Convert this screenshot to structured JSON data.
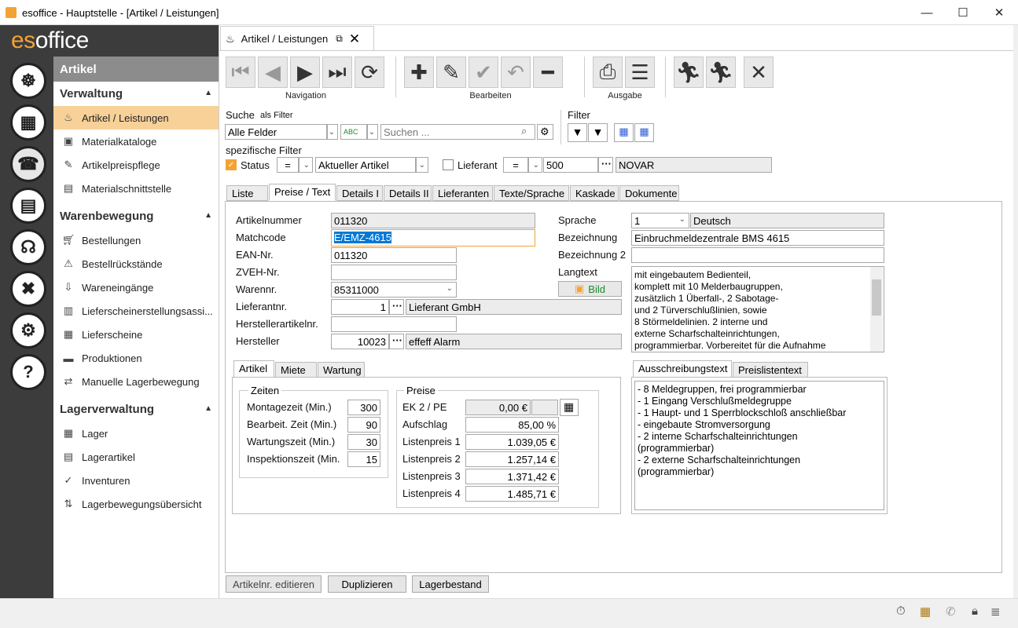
{
  "window": {
    "title": "esoffice - Hauptstelle - [Artikel / Leistungen]",
    "minimize": "—",
    "maximize": "☐",
    "close": "✕"
  },
  "logo": {
    "es": "es",
    "office": "office"
  },
  "rail": [
    "☸",
    "▦",
    "☎",
    "▤",
    "☊",
    "✖",
    "⚙",
    "?"
  ],
  "nav": {
    "header": "Artikel",
    "sections": [
      {
        "title": "Verwaltung",
        "items": [
          "Artikel / Leistungen",
          "Materialkataloge",
          "Artikelpreispflege",
          "Materialschnittstelle"
        ]
      },
      {
        "title": "Warenbewegung",
        "items": [
          "Bestellungen",
          "Bestellrückstände",
          "Wareneingänge",
          "Lieferscheinerstellungsassi...",
          "Lieferscheine",
          "Produktionen",
          "Manuelle Lagerbewegung"
        ]
      },
      {
        "title": "Lagerverwaltung",
        "items": [
          "Lager",
          "Lagerartikel",
          "Inventuren",
          "Lagerbewegungsübersicht"
        ]
      }
    ]
  },
  "doctab": {
    "label": "Artikel / Leistungen"
  },
  "toolbar": {
    "navigation": "Navigation",
    "bearbeiten": "Bearbeiten",
    "ausgabe": "Ausgabe"
  },
  "search": {
    "label": "Suche",
    "as_filter": "als Filter",
    "field": "Alle Felder",
    "placeholder": "Suchen ...",
    "filter_label": "Filter"
  },
  "specific": {
    "label": "spezifische Filter",
    "status": "Status",
    "op1": "=",
    "status_value": "Aktueller Artikel",
    "lieferant": "Lieferant",
    "op2": "=",
    "lief_nr": "500",
    "lief_name": "NOVAR"
  },
  "main_tabs": [
    "Liste",
    "Preise / Text",
    "Details I",
    "Details II",
    "Lieferanten",
    "Texte/Sprache",
    "Kaskade",
    "Dokumente"
  ],
  "form": {
    "artikelnummer_l": "Artikelnummer",
    "artikelnummer": "011320",
    "matchcode_l": "Matchcode",
    "matchcode": "E/EMZ-4615",
    "ean_l": "EAN-Nr.",
    "ean": "011320",
    "zveh_l": "ZVEH-Nr.",
    "zveh": "",
    "warennr_l": "Warennr.",
    "warennr": "85311000",
    "lieferantnr_l": "Lieferantnr.",
    "lieferantnr": "1",
    "lieferant_name": "Lieferant GmbH",
    "herstellerart_l": "Herstellerartikelnr.",
    "herstellerart": "",
    "hersteller_l": "Hersteller",
    "hersteller": "10023",
    "hersteller_name": "effeff Alarm",
    "sprache_l": "Sprache",
    "sprache": "1",
    "sprache_name": "Deutsch",
    "bez_l": "Bezeichnung",
    "bez": "Einbruchmeldezentrale BMS 4615",
    "bez2_l": "Bezeichnung 2",
    "bez2": "",
    "langtext_l": "Langtext",
    "bild": "Bild",
    "langtext": [
      "mit eingebautem Bedienteil,",
      "komplett mit 10 Melderbaugruppen,",
      "zusätzlich 1 Überfall-, 2 Sabotage-",
      "und 2 Türverschlußlinien, sowie",
      "8 Störmeldelinien. 2 interne und",
      "externe Scharfschalteinrichtungen,",
      "programmierbar. Vorbereitet für die Aufnahme"
    ]
  },
  "sub_tabs": [
    "Artikel",
    "Miete",
    "Wartung"
  ],
  "zeiten": {
    "title": "Zeiten",
    "rows": [
      {
        "l": "Montagezeit (Min.)",
        "v": "300"
      },
      {
        "l": "Bearbeit. Zeit (Min.)",
        "v": "90"
      },
      {
        "l": "Wartungszeit (Min.)",
        "v": "30"
      },
      {
        "l": "Inspektionszeit (Min.",
        "v": "15"
      }
    ]
  },
  "preise": {
    "title": "Preise",
    "ek_l": "EK 2 / PE",
    "ek": "0,00 €",
    "aufschlag_l": "Aufschlag",
    "aufschlag": "85,00 %",
    "rows": [
      {
        "l": "Listenpreis 1",
        "v": "1.039,05 €"
      },
      {
        "l": "Listenpreis 2",
        "v": "1.257,14 €"
      },
      {
        "l": "Listenpreis 3",
        "v": "1.371,42 €"
      },
      {
        "l": "Listenpreis 4",
        "v": "1.485,71 €"
      }
    ]
  },
  "text_tabs": [
    "Ausschreibungstext",
    "Preislistentext"
  ],
  "ausschreibung": [
    "- 8 Meldegruppen, frei programmierbar",
    "- 1 Eingang Verschlußmeldegruppe",
    "- 1 Haupt- und 1 Sperrblockschloß anschließbar",
    "- eingebaute Stromversorgung",
    "- 2 interne Scharfschalteinrichtungen",
    "(programmierbar)",
    "- 2 externe Scharfschalteinrichtungen",
    "(programmierbar)"
  ],
  "buttons": {
    "edit": "Artikelnr. editieren",
    "dup": "Duplizieren",
    "lager": "Lagerbestand"
  }
}
